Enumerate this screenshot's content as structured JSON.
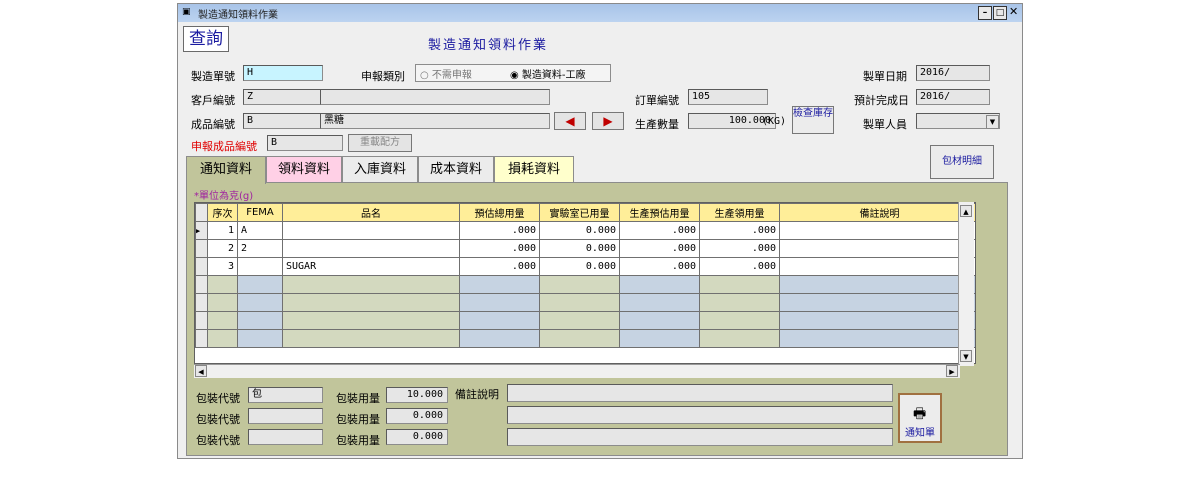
{
  "window": {
    "title": "製造通知領料作業",
    "header_title": "製造通知領料作業",
    "query_label": "查詢"
  },
  "form": {
    "order_no_label": "製造單號",
    "order_no_value": "H",
    "report_type_label": "申報類別",
    "report_options": [
      "不需申報",
      "製造資料-工廠"
    ],
    "report_selected": 1,
    "make_date_label": "製單日期",
    "make_date_value": "2016/",
    "customer_label": "客戶編號",
    "customer_value": "Z",
    "customer_name": "",
    "purchase_no_label": "訂單編號",
    "purchase_no_value": "105",
    "finish_date_label": "預計完成日",
    "finish_date_value": "2016/",
    "product_label": "成品編號",
    "product_value": "B",
    "product_name": "黑糖",
    "qty_label": "生產數量",
    "qty_value": "100.000",
    "qty_unit": "(KG)",
    "check_stock_label": "檢查庫存",
    "maker_label": "製單人員",
    "maker_value": "",
    "report_product_label": "申報成品編號",
    "report_product_value": "B",
    "reload_label": "重載配方",
    "package_detail_label": "包材明細"
  },
  "tabs": [
    {
      "label": "通知資料",
      "bg": "#c1c59b"
    },
    {
      "label": "領料資料",
      "bg": "#ffd0e6"
    },
    {
      "label": "入庫資料",
      "bg": "#ececec"
    },
    {
      "label": "成本資料",
      "bg": "#ececec"
    },
    {
      "label": "損耗資料",
      "bg": "#ffffcc"
    }
  ],
  "grid": {
    "unit_note": "*單位為克(g)",
    "headers": [
      "序次",
      "FEMA",
      "品名",
      "預估總用量",
      "實驗室已用量",
      "生產預估用量",
      "生產領用量",
      "備註說明"
    ],
    "rows": [
      [
        "1",
        "A",
        "",
        ".000",
        "0.000",
        ".000",
        ".000",
        ""
      ],
      [
        "2",
        "2",
        "",
        ".000",
        "0.000",
        ".000",
        ".000",
        ""
      ],
      [
        "3",
        "",
        "SUGAR",
        ".000",
        "0.000",
        ".000",
        ".000",
        ""
      ]
    ]
  },
  "packing": {
    "code_label": "包裝代號",
    "qty_label": "包裝用量",
    "note_label": "備註說明",
    "rows": [
      {
        "code": "包",
        "qty": "10.000"
      },
      {
        "code": "",
        "qty": "0.000"
      },
      {
        "code": "",
        "qty": "0.000"
      }
    ],
    "print_label": "通知單"
  },
  "colors": {
    "cyan_field": "#c8f4ff",
    "red_label": "#e00000",
    "grid_header": "#ffee99",
    "panel_bg": "#c1c59b",
    "header_title_blue": "#1a1aa0"
  }
}
